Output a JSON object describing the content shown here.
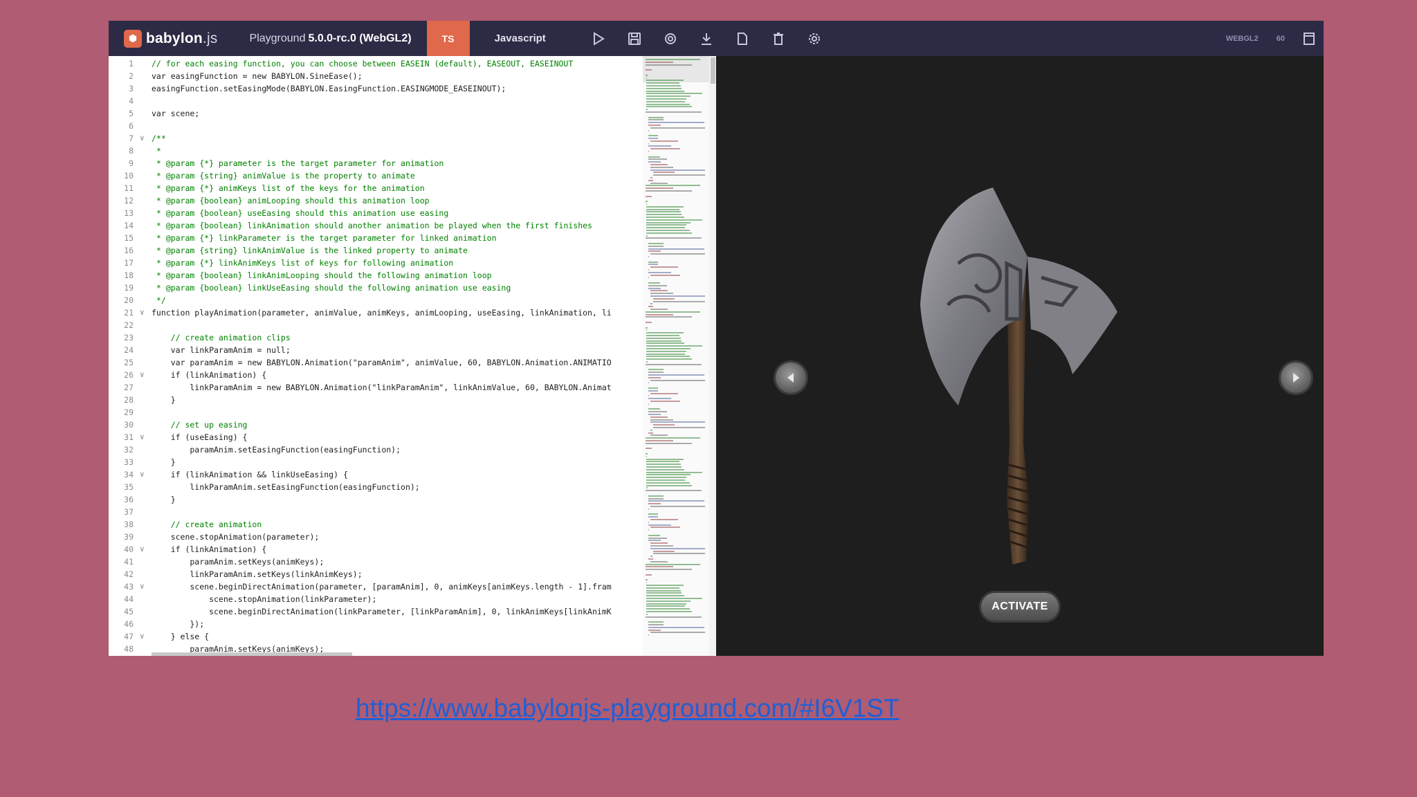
{
  "app": {
    "logo_text": "babylon",
    "logo_suffix": ".js",
    "playground_label": "Playground",
    "version": "5.0.0-rc.0 (WebGL2)",
    "tab_ts": "TS",
    "tab_js": "Javascript",
    "engine_label": "WEBGL2",
    "fps_label": "60"
  },
  "toolbar": {
    "icons": [
      "play-icon",
      "save-icon",
      "inspector-icon",
      "download-icon",
      "new-file-icon",
      "clear-icon",
      "settings-icon"
    ]
  },
  "editor": {
    "lines": [
      {
        "n": "1",
        "text": "// for each easing function, you can choose between EASEIN (default), EASEOUT, EASEINOUT",
        "kind": "comment"
      },
      {
        "n": "2",
        "text": "var easingFunction = new BABYLON.SineEase();",
        "kind": "plain"
      },
      {
        "n": "3",
        "text": "easingFunction.setEasingMode(BABYLON.EasingFunction.EASINGMODE_EASEINOUT);",
        "kind": "plain"
      },
      {
        "n": "4",
        "text": "",
        "kind": "plain"
      },
      {
        "n": "5",
        "text": "var scene;",
        "kind": "plain"
      },
      {
        "n": "6",
        "text": "",
        "kind": "plain"
      },
      {
        "n": "7",
        "text": "/**",
        "kind": "comment",
        "fold": true
      },
      {
        "n": "8",
        "text": " *",
        "kind": "comment"
      },
      {
        "n": "9",
        "text": " * @param {*} parameter is the target parameter for animation",
        "kind": "comment"
      },
      {
        "n": "10",
        "text": " * @param {string} animValue is the property to animate",
        "kind": "comment"
      },
      {
        "n": "11",
        "text": " * @param {*} animKeys list of the keys for the animation",
        "kind": "comment"
      },
      {
        "n": "12",
        "text": " * @param {boolean} animLooping should this animation loop",
        "kind": "comment"
      },
      {
        "n": "13",
        "text": " * @param {boolean} useEasing should this animation use easing",
        "kind": "comment"
      },
      {
        "n": "14",
        "text": " * @param {boolean} linkAnimation should another animation be played when the first finishes",
        "kind": "comment"
      },
      {
        "n": "15",
        "text": " * @param {*} linkParameter is the target parameter for linked animation",
        "kind": "comment"
      },
      {
        "n": "16",
        "text": " * @param {string} linkAnimValue is the linked property to animate",
        "kind": "comment"
      },
      {
        "n": "17",
        "text": " * @param {*} linkAnimKeys list of keys for following animation",
        "kind": "comment"
      },
      {
        "n": "18",
        "text": " * @param {boolean} linkAnimLooping should the following animation loop",
        "kind": "comment"
      },
      {
        "n": "19",
        "text": " * @param {boolean} linkUseEasing should the following animation use easing",
        "kind": "comment"
      },
      {
        "n": "20",
        "text": " */",
        "kind": "comment"
      },
      {
        "n": "21",
        "text": "function playAnimation(parameter, animValue, animKeys, animLooping, useEasing, linkAnimation, li",
        "kind": "plain",
        "fold": true
      },
      {
        "n": "22",
        "text": "",
        "kind": "plain"
      },
      {
        "n": "23",
        "text": "    // create animation clips",
        "kind": "comment"
      },
      {
        "n": "24",
        "text": "    var linkParamAnim = null;",
        "kind": "plain"
      },
      {
        "n": "25",
        "text": "    var paramAnim = new BABYLON.Animation(\"paramAnim\", animValue, 60, BABYLON.Animation.ANIMATIO",
        "kind": "plain"
      },
      {
        "n": "26",
        "text": "    if (linkAnimation) {",
        "kind": "plain",
        "fold": true
      },
      {
        "n": "27",
        "text": "        linkParamAnim = new BABYLON.Animation(\"linkParamAnim\", linkAnimValue, 60, BABYLON.Animat",
        "kind": "plain"
      },
      {
        "n": "28",
        "text": "    }",
        "kind": "plain"
      },
      {
        "n": "29",
        "text": "",
        "kind": "plain"
      },
      {
        "n": "30",
        "text": "    // set up easing",
        "kind": "comment"
      },
      {
        "n": "31",
        "text": "    if (useEasing) {",
        "kind": "plain",
        "fold": true
      },
      {
        "n": "32",
        "text": "        paramAnim.setEasingFunction(easingFunction);",
        "kind": "plain"
      },
      {
        "n": "33",
        "text": "    }",
        "kind": "plain"
      },
      {
        "n": "34",
        "text": "    if (linkAnimation && linkUseEasing) {",
        "kind": "plain",
        "fold": true
      },
      {
        "n": "35",
        "text": "        linkParamAnim.setEasingFunction(easingFunction);",
        "kind": "plain"
      },
      {
        "n": "36",
        "text": "    }",
        "kind": "plain"
      },
      {
        "n": "37",
        "text": "",
        "kind": "plain"
      },
      {
        "n": "38",
        "text": "    // create animation",
        "kind": "comment"
      },
      {
        "n": "39",
        "text": "    scene.stopAnimation(parameter);",
        "kind": "plain"
      },
      {
        "n": "40",
        "text": "    if (linkAnimation) {",
        "kind": "plain",
        "fold": true
      },
      {
        "n": "41",
        "text": "        paramAnim.setKeys(animKeys);",
        "kind": "plain"
      },
      {
        "n": "42",
        "text": "        linkParamAnim.setKeys(linkAnimKeys);",
        "kind": "plain"
      },
      {
        "n": "43",
        "text": "        scene.beginDirectAnimation(parameter, [paramAnim], 0, animKeys[animKeys.length - 1].fram",
        "kind": "plain",
        "fold": true
      },
      {
        "n": "44",
        "text": "            scene.stopAnimation(linkParameter);",
        "kind": "plain"
      },
      {
        "n": "45",
        "text": "            scene.beginDirectAnimation(linkParameter, [linkParamAnim], 0, linkAnimKeys[linkAnimK",
        "kind": "plain"
      },
      {
        "n": "46",
        "text": "        });",
        "kind": "plain"
      },
      {
        "n": "47",
        "text": "    } else {",
        "kind": "plain",
        "fold": true
      },
      {
        "n": "48",
        "text": "        paramAnim.setKeys(animKeys);",
        "kind": "plain"
      }
    ]
  },
  "viewport": {
    "activate_label": "ACTIVATE",
    "prev_icon": "prev-arrow-icon",
    "next_icon": "next-arrow-icon"
  },
  "footer": {
    "url": "https://www.babylonjs-playground.com/#I6V1ST"
  },
  "colors": {
    "background": "#b05c72",
    "topbar": "#2d2a45",
    "accent": "#e0684b",
    "link": "#1f5fd6"
  }
}
